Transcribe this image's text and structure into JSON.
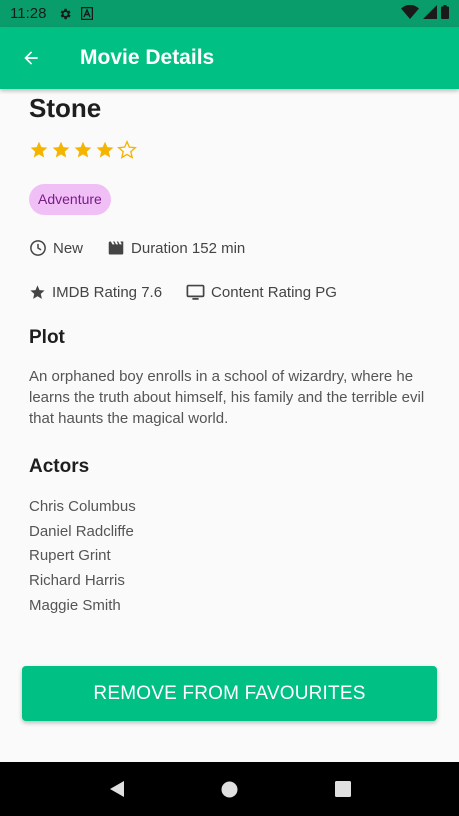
{
  "status_bar": {
    "time": "11:28",
    "icons": [
      "gear-icon",
      "a-badge-icon",
      "wifi-icon",
      "signal-icon",
      "battery-icon"
    ]
  },
  "app_bar": {
    "title": "Movie Details",
    "back_icon": "arrow-left-icon"
  },
  "movie": {
    "title": "Stone",
    "rating_stars": {
      "filled": 4,
      "total": 5,
      "color": "#f4b400"
    },
    "genre": "Adventure",
    "status": "New",
    "duration": "Duration 152 min",
    "imdb": "IMDB Rating 7.6",
    "content_rating": "Content Rating PG"
  },
  "plot": {
    "heading": "Plot",
    "text": "An orphaned boy enrolls in a school of wizardry, where he learns the truth about himself, his family and the terrible evil that haunts the magical world."
  },
  "actors": {
    "heading": "Actors",
    "list": [
      "Chris Columbus",
      "Daniel Radcliffe",
      "Rupert Grint",
      "Richard Harris",
      "Maggie Smith"
    ]
  },
  "action_button": {
    "label": "REMOVE FROM FAVOURITES"
  },
  "colors": {
    "accent": "#00c083",
    "status_bar": "#0a9d6c",
    "chip_bg": "#f0bff6",
    "chip_text": "#7a1b8a"
  }
}
